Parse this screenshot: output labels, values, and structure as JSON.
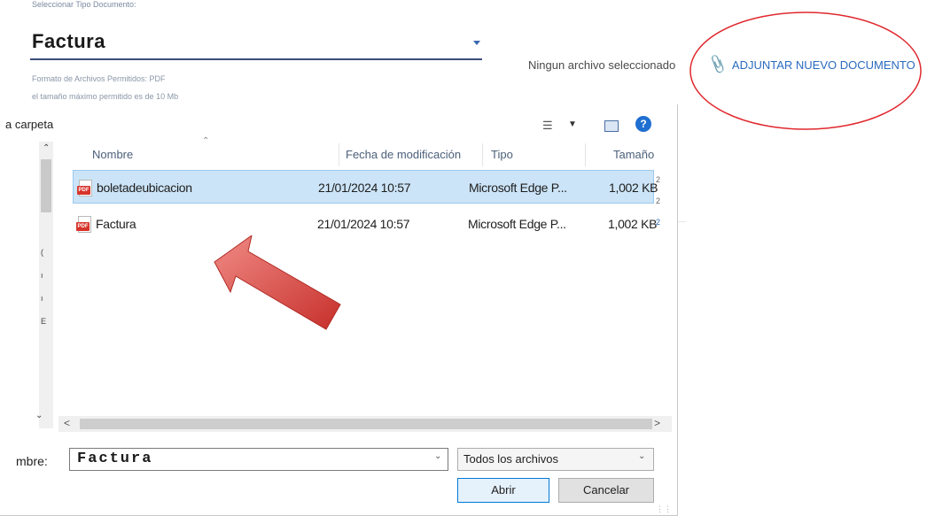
{
  "form": {
    "doc_type_label": "Seleccionar Tipo Documento:",
    "doc_type_value": "Factura",
    "hint_format": "Formato de Archivos Permitidos: PDF",
    "hint_size": "el tamaño máximo permitido es de 10 Mb",
    "no_file_text": "Ningun archivo seleccionado",
    "attach_button": "ADJUNTAR NUEVO DOCUMENTO",
    "attach_icon": "paperclip-icon",
    "highlight_color": "#e0282e"
  },
  "dialog": {
    "new_folder": "a carpeta",
    "columns": {
      "name": "Nombre",
      "modified": "Fecha de modificación",
      "type": "Tipo",
      "size": "Tamaño"
    },
    "files": [
      {
        "name": "boletadeubicacion",
        "modified": "21/01/2024 10:57",
        "type": "Microsoft Edge P...",
        "size": "1,002 KB",
        "selected": true,
        "icon": "pdf-icon"
      },
      {
        "name": "Factura",
        "modified": "21/01/2024 10:57",
        "type": "Microsoft Edge P...",
        "size": "1,002 KB",
        "selected": false,
        "icon": "pdf-icon"
      }
    ],
    "filename_label": "mbre:",
    "filename_value": "Factura",
    "file_type_filter": "Todos los archivos",
    "open_button": "Abrir",
    "cancel_button": "Cancelar",
    "accent_color": "#0078d7",
    "arrow_color": "#e04a45"
  }
}
